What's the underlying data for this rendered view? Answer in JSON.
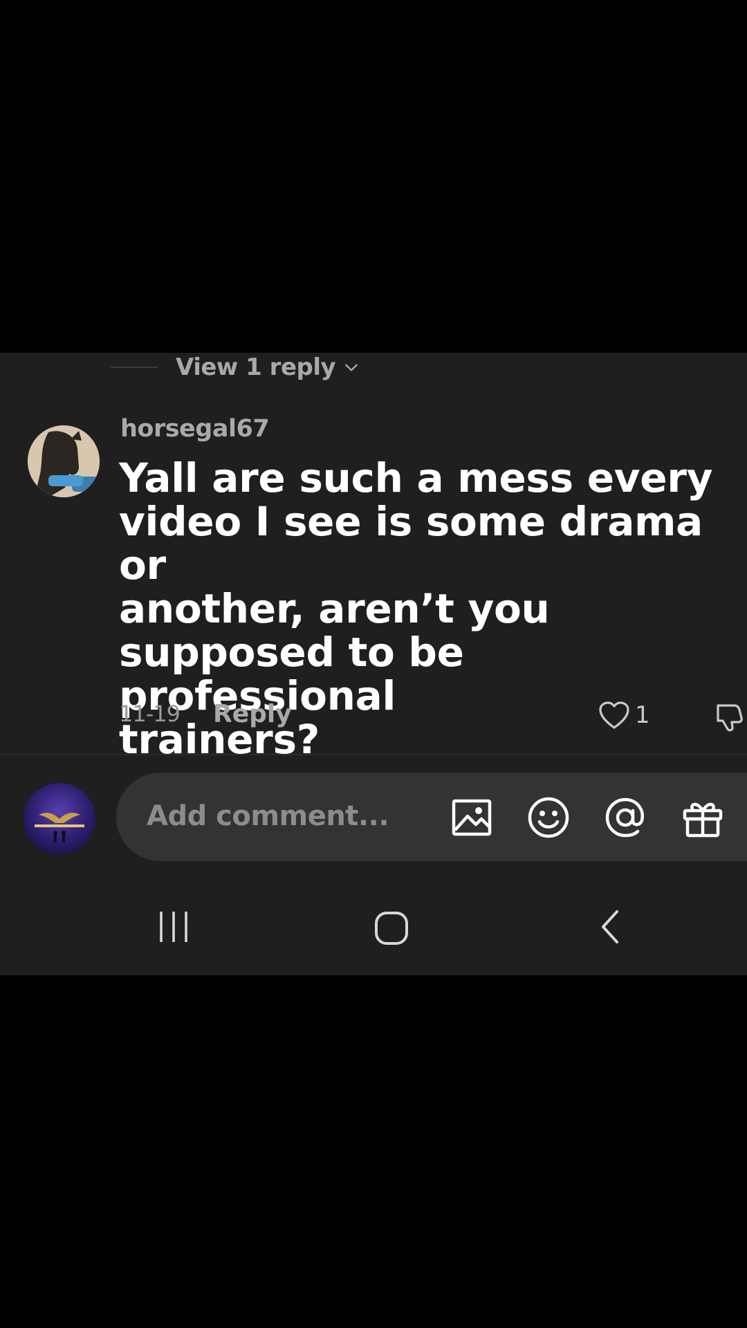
{
  "thread": {
    "view_replies_label": "View 1 reply"
  },
  "comment": {
    "username": "horsegal67",
    "text": "Yall are such a mess every\nvideo I see is some drama or\nanother, aren’t you\nsupposed to be professional\ntrainers?",
    "date": "11-19",
    "reply_label": "Reply",
    "like_count": "1"
  },
  "composer": {
    "placeholder": "Add comment..."
  },
  "icons": {
    "chevron": "chevron-down-icon",
    "like": "heart-icon",
    "dislike": "thumbs-down-icon",
    "image": "image-icon",
    "emoji": "emoji-icon",
    "mention": "at-icon",
    "gift": "gift-icon",
    "recents": "recents-icon",
    "home": "home-icon",
    "back": "back-icon"
  },
  "colors": {
    "panel": "#1f1f1f",
    "background": "#000000",
    "text": "#ffffff",
    "muted": "#a9a9a9"
  }
}
